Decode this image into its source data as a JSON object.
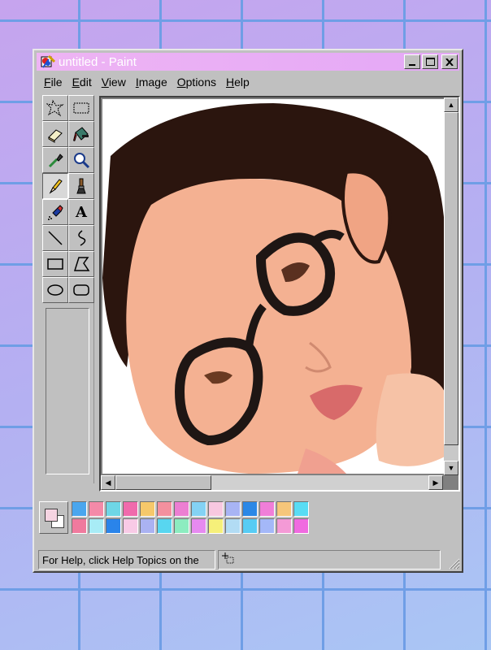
{
  "window": {
    "title": "untitled - Paint",
    "controls": {
      "minimize": "_",
      "maximize": "□",
      "close": "✕"
    }
  },
  "menu": [
    {
      "label": "File",
      "access": "F",
      "rest": "ile"
    },
    {
      "label": "Edit",
      "access": "E",
      "rest": "dit"
    },
    {
      "label": "View",
      "access": "V",
      "rest": "iew"
    },
    {
      "label": "Image",
      "access": "I",
      "rest": "mage"
    },
    {
      "label": "Options",
      "access": "O",
      "rest": "ptions"
    },
    {
      "label": "Help",
      "access": "H",
      "rest": "elp"
    }
  ],
  "tools": [
    {
      "name": "free-form-select-icon",
      "selected": false
    },
    {
      "name": "select-icon",
      "selected": false
    },
    {
      "name": "eraser-icon",
      "selected": false
    },
    {
      "name": "fill-bucket-icon",
      "selected": false
    },
    {
      "name": "color-picker-icon",
      "selected": false
    },
    {
      "name": "magnifier-icon",
      "selected": false
    },
    {
      "name": "pencil-icon",
      "selected": true
    },
    {
      "name": "brush-icon",
      "selected": false
    },
    {
      "name": "airbrush-icon",
      "selected": false
    },
    {
      "name": "text-icon",
      "selected": false,
      "glyph": "A"
    },
    {
      "name": "line-icon",
      "selected": false
    },
    {
      "name": "curve-icon",
      "selected": false
    },
    {
      "name": "rectangle-icon",
      "selected": false
    },
    {
      "name": "polygon-icon",
      "selected": false
    },
    {
      "name": "ellipse-icon",
      "selected": false
    },
    {
      "name": "rounded-rectangle-icon",
      "selected": false
    }
  ],
  "colors": {
    "foreground": "#f6d4e2",
    "background": "#ffffff",
    "palette": [
      "#4aa6ee",
      "#f48aa8",
      "#6ed6e6",
      "#f06aac",
      "#f6c86a",
      "#f4909e",
      "#ec7ed2",
      "#84d2f4",
      "#f8c8e0",
      "#a8b4f4",
      "#2a88e6",
      "#f07ed8",
      "#f6c67a",
      "#58dcf4",
      "#f07a9e",
      "#a8ecf6",
      "#2a84ea",
      "#f8cae6",
      "#aab2f2",
      "#58d6f0",
      "#8cecc0",
      "#e68af0",
      "#f6f07a",
      "#b2dcf4",
      "#58ccf4",
      "#a4b8f8",
      "#f49ad6",
      "#f06ae0"
    ]
  },
  "status": {
    "help_text": "For Help, click Help Topics on the",
    "position_icon": "crosshair-position-icon"
  },
  "canvas": {
    "image_description_icon": "portrait-image"
  }
}
